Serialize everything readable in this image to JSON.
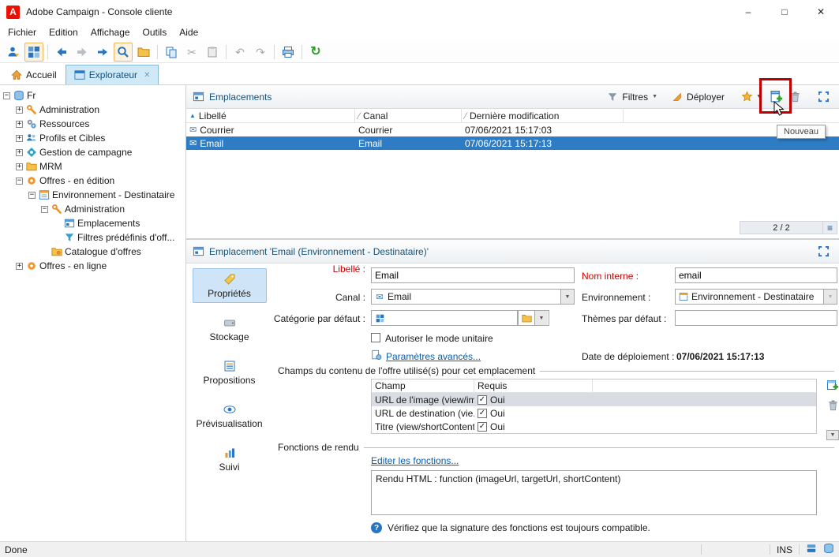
{
  "window": {
    "title": "Adobe Campaign - Console cliente"
  },
  "menu": {
    "items": [
      "Fichier",
      "Edition",
      "Affichage",
      "Outils",
      "Aide"
    ]
  },
  "tabs": {
    "home": "Accueil",
    "explorer": "Explorateur"
  },
  "icons": {
    "adobe": "A",
    "minimize": "–",
    "maximize": "□",
    "close": "✕",
    "plus": "+",
    "minus": "−",
    "caret_down": "▼",
    "sort_asc": "▲",
    "slash": "⁄",
    "menu": "≡",
    "check": "✓",
    "cut": "✂",
    "undo": "↶",
    "redo": "↷",
    "refresh": "↻",
    "tab_close": "✕",
    "question": "?",
    "envelope": "✉"
  },
  "tree": {
    "items": [
      {
        "label": "Fr",
        "exp": "−"
      },
      {
        "label": "Administration",
        "exp": "+"
      },
      {
        "label": "Ressources",
        "exp": "+"
      },
      {
        "label": "Profils et Cibles",
        "exp": "+"
      },
      {
        "label": "Gestion de campagne",
        "exp": "+"
      },
      {
        "label": "MRM",
        "exp": "+"
      },
      {
        "label": "Offres - en édition",
        "exp": "−"
      },
      {
        "label": "Environnement - Destinataire",
        "exp": "−"
      },
      {
        "label": "Administration",
        "exp": "−"
      },
      {
        "label": "Emplacements",
        "exp": ""
      },
      {
        "label": "Filtres prédéfinis d'off...",
        "exp": ""
      },
      {
        "label": "Catalogue d'offres",
        "exp": ""
      },
      {
        "label": "Offres - en ligne",
        "exp": "+"
      }
    ]
  },
  "list_panel": {
    "title": "Emplacements",
    "filters_button": "Filtres",
    "deploy_button": "Déployer",
    "columns": {
      "libelle": "Libellé",
      "canal": "Canal",
      "modified": "Dernière modification"
    },
    "rows": [
      {
        "libelle": "Courrier",
        "canal": "Courrier",
        "modified": "07/06/2021 15:17:03"
      },
      {
        "libelle": "Email",
        "canal": "Email",
        "modified": "07/06/2021 15:17:13"
      }
    ],
    "count": "2 / 2"
  },
  "annotation": {
    "tooltip": "Nouveau"
  },
  "detail": {
    "title": "Emplacement 'Email (Environnement - Destinataire)'",
    "tabs": {
      "proprietes": "Propriétés",
      "stockage": "Stockage",
      "propositions": "Propositions",
      "previsualisation": "Prévisualisation",
      "suivi": "Suivi"
    },
    "form": {
      "libelle_label": "Libellé :",
      "libelle_value": "Email",
      "nom_interne_label": "Nom interne :",
      "nom_interne_value": "email",
      "canal_label": "Canal :",
      "canal_value": "Email",
      "environnement_label": "Environnement :",
      "environnement_value": "Environnement - Destinataire",
      "categorie_label": "Catégorie par défaut :",
      "categorie_value": "",
      "themes_label": "Thèmes par défaut :",
      "themes_value": "",
      "unitaire_label": "Autoriser le mode unitaire",
      "avances_link": "Paramètres avancés...",
      "deploiement_label": "Date de déploiement :",
      "deploiement_value": "07/06/2021 15:17:13",
      "champs_legend": "Champs du contenu de l'offre utilisé(s) pour cet emplacement",
      "champs_columns": {
        "champ": "Champ",
        "requis": "Requis"
      },
      "champs_rows": [
        {
          "champ": "URL de l'image (view/ima...",
          "requis": "Oui"
        },
        {
          "champ": "URL de destination (vie...",
          "requis": "Oui"
        },
        {
          "champ": "Titre (view/shortContent)",
          "requis": "Oui"
        }
      ],
      "fonctions_label": "Fonctions de rendu",
      "editer_link": "Editer les fonctions...",
      "rendu_value": "Rendu HTML : function (imageUrl, targetUrl, shortContent)",
      "note": "Vérifiez que la signature des fonctions est toujours compatible."
    }
  },
  "statusbar": {
    "text": "Done",
    "ins": "INS"
  }
}
